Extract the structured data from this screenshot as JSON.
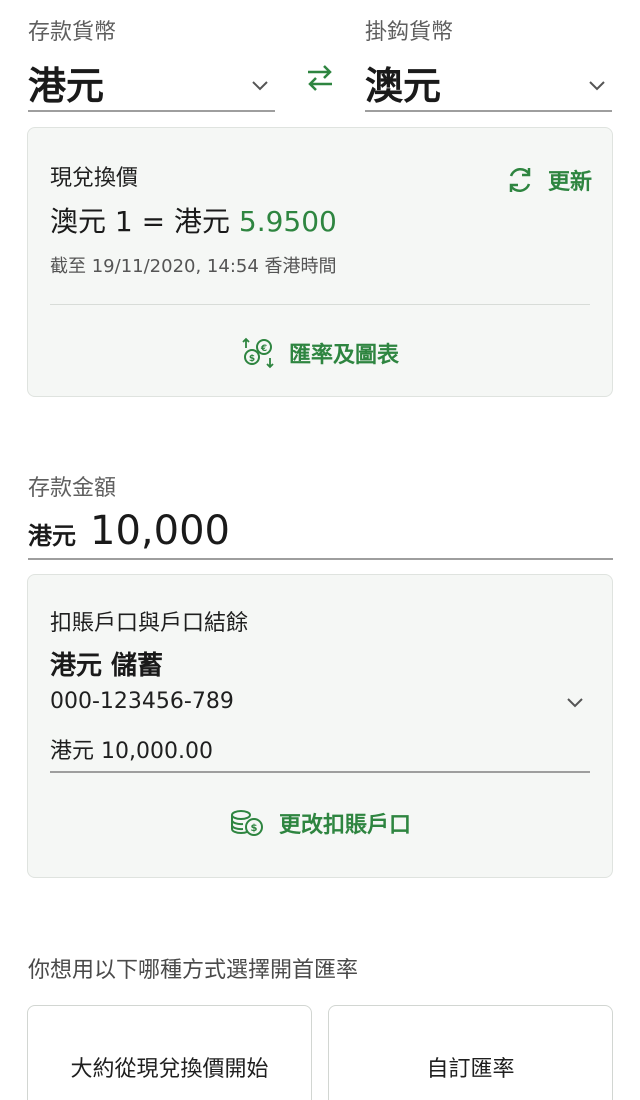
{
  "deposit_currency": {
    "label": "存款貨幣",
    "value": "港元"
  },
  "linked_currency": {
    "label": "掛鈎貨幣",
    "value": "澳元"
  },
  "rate_card": {
    "title": "現兌換價",
    "refresh_label": "更新",
    "rate_prefix": "澳元 1 = 港元",
    "rate_value": "5.9500",
    "timestamp": "截至 19/11/2020, 14:54 香港時間",
    "chart_link": "匯率及圖表"
  },
  "amount": {
    "label": "存款金額",
    "currency": "港元",
    "value": "10,000"
  },
  "account_card": {
    "title": "扣賬戶口與戶口結餘",
    "account_name": "港元 儲蓄",
    "account_number": "000-123456-789",
    "balance": "港元 10,000.00",
    "change_link": "更改扣賬戶口"
  },
  "rate_choice": {
    "question": "你想用以下哪種方式選擇開首匯率",
    "option_1": "大約從現兌換價開始",
    "option_2": "自訂匯率"
  },
  "colors": {
    "accent": "#2e8540",
    "card_bg": "#f5f7f5"
  }
}
